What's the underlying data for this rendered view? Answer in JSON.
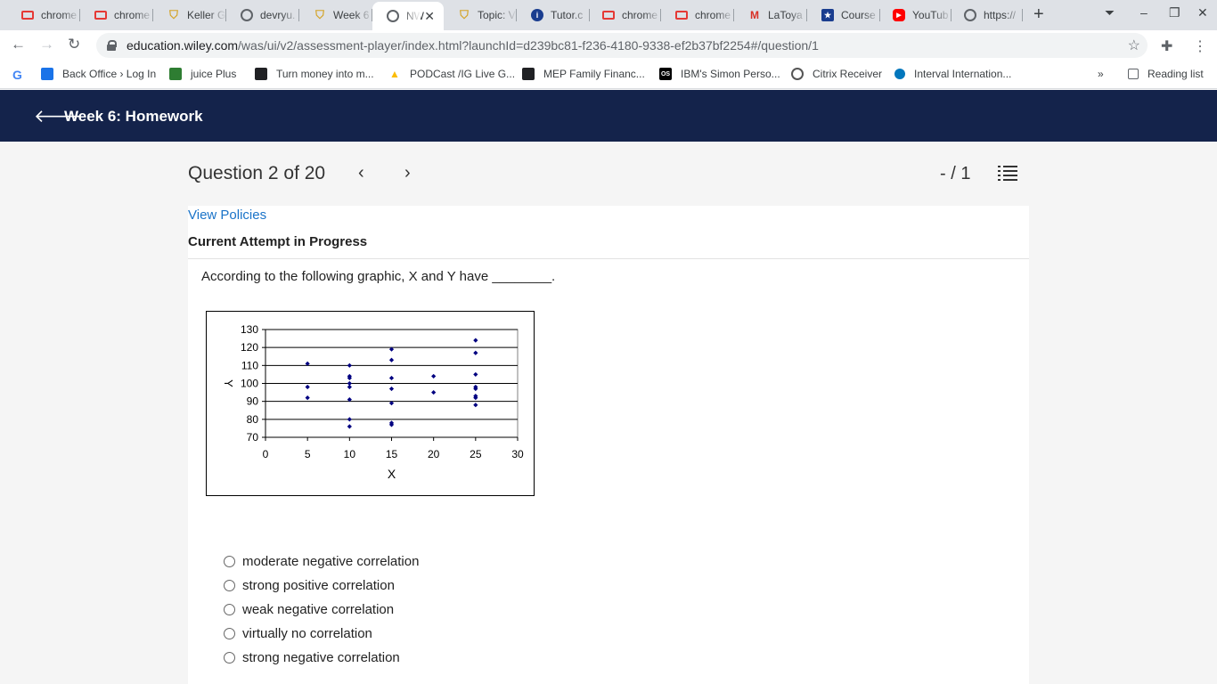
{
  "browser": {
    "tabs": [
      {
        "title": "chrome",
        "favicon": "red-app-icon",
        "color": "#e53935"
      },
      {
        "title": "chrome",
        "favicon": "red-app-icon",
        "color": "#e53935"
      },
      {
        "title": "Keller G",
        "favicon": "shield-icon",
        "color": "#d4a429"
      },
      {
        "title": "devryu.",
        "favicon": "globe-icon",
        "color": "#5f6368"
      },
      {
        "title": "Week 6",
        "favicon": "shield-icon",
        "color": "#d4a429"
      },
      {
        "title": "NW",
        "favicon": "globe-icon",
        "color": "#5f6368",
        "active": true
      },
      {
        "title": "Topic: V",
        "favicon": "shield-icon",
        "color": "#d4a429"
      },
      {
        "title": "Tutor.c",
        "favicon": "info-icon",
        "color": "#1a3d8f"
      },
      {
        "title": "chrome",
        "favicon": "red-app-icon",
        "color": "#e53935"
      },
      {
        "title": "chrome",
        "favicon": "red-app-icon",
        "color": "#e53935"
      },
      {
        "title": "LaToya",
        "favicon": "gmail-icon",
        "color": "#ffffff"
      },
      {
        "title": "Course",
        "favicon": "star-badge-icon",
        "color": "#1a3d8f"
      },
      {
        "title": "YouTub",
        "favicon": "youtube-icon",
        "color": "#ff0000"
      },
      {
        "title": "https://",
        "favicon": "globe-icon",
        "color": "#5f6368"
      }
    ],
    "new_tab_symbol": "+",
    "url_host": "education.wiley.com",
    "url_path": "/was/ui/v2/assessment-player/index.html?launchId=d239bc81-f236-4180-9338-ef2b37bf2254#/question/1",
    "bookmarks": [
      {
        "label": "Back Office › Log In",
        "favicon": "grid-icon",
        "color": "#1a73e8"
      },
      {
        "label": "juice Plus",
        "favicon": "juice-plus-icon",
        "color": "#2e7d32"
      },
      {
        "label": "Turn money into m...",
        "favicon": "shield-icon",
        "color": "#202124"
      },
      {
        "label": "PODCast /IG Live G...",
        "favicon": "drive-icon",
        "color": "#fbbc04"
      },
      {
        "label": "MEP Family Financ...",
        "favicon": "k-logo-icon",
        "color": "#202124"
      },
      {
        "label": "IBM's Simon Perso...",
        "favicon": "os-logo-icon",
        "color": "#000000"
      },
      {
        "label": "Citrix Receiver",
        "favicon": "citrix-icon",
        "color": "#555555"
      },
      {
        "label": "Interval Internation...",
        "favicon": "circle-icon",
        "color": "#0277bd"
      }
    ],
    "more_bookmarks": "»",
    "reading_list": "Reading list"
  },
  "app": {
    "title": "Week 6: Homework",
    "question_counter": "Question 2 of 20",
    "score": "- / 1",
    "view_policies": "View Policies",
    "attempt_status": "Current Attempt in Progress",
    "question_text": "According to the following graphic, X and Y have ________.",
    "options": [
      "moderate negative correlation",
      "strong positive correlation",
      "weak negative correlation",
      "virtually no correlation",
      "strong negative correlation"
    ]
  },
  "chart_data": {
    "type": "scatter",
    "title": "",
    "xlabel": "X",
    "ylabel": "Y",
    "xlim": [
      0,
      30
    ],
    "ylim": [
      70,
      130
    ],
    "xticks": [
      0,
      5,
      10,
      15,
      20,
      25,
      30
    ],
    "yticks": [
      70,
      80,
      90,
      100,
      110,
      120,
      130
    ],
    "grid": "horizontal",
    "points": [
      {
        "x": 5,
        "y": 111
      },
      {
        "x": 5,
        "y": 98
      },
      {
        "x": 5,
        "y": 92
      },
      {
        "x": 10,
        "y": 110
      },
      {
        "x": 10,
        "y": 104
      },
      {
        "x": 10,
        "y": 103
      },
      {
        "x": 10,
        "y": 100
      },
      {
        "x": 10,
        "y": 98
      },
      {
        "x": 10,
        "y": 91
      },
      {
        "x": 10,
        "y": 80
      },
      {
        "x": 10,
        "y": 76
      },
      {
        "x": 15,
        "y": 119
      },
      {
        "x": 15,
        "y": 113
      },
      {
        "x": 15,
        "y": 103
      },
      {
        "x": 15,
        "y": 97
      },
      {
        "x": 15,
        "y": 89
      },
      {
        "x": 15,
        "y": 78
      },
      {
        "x": 15,
        "y": 77
      },
      {
        "x": 20,
        "y": 104
      },
      {
        "x": 20,
        "y": 95
      },
      {
        "x": 25,
        "y": 124
      },
      {
        "x": 25,
        "y": 117
      },
      {
        "x": 25,
        "y": 105
      },
      {
        "x": 25,
        "y": 98
      },
      {
        "x": 25,
        "y": 97
      },
      {
        "x": 25,
        "y": 93
      },
      {
        "x": 25,
        "y": 92
      },
      {
        "x": 25,
        "y": 88
      }
    ],
    "marker_color": "#000080"
  }
}
